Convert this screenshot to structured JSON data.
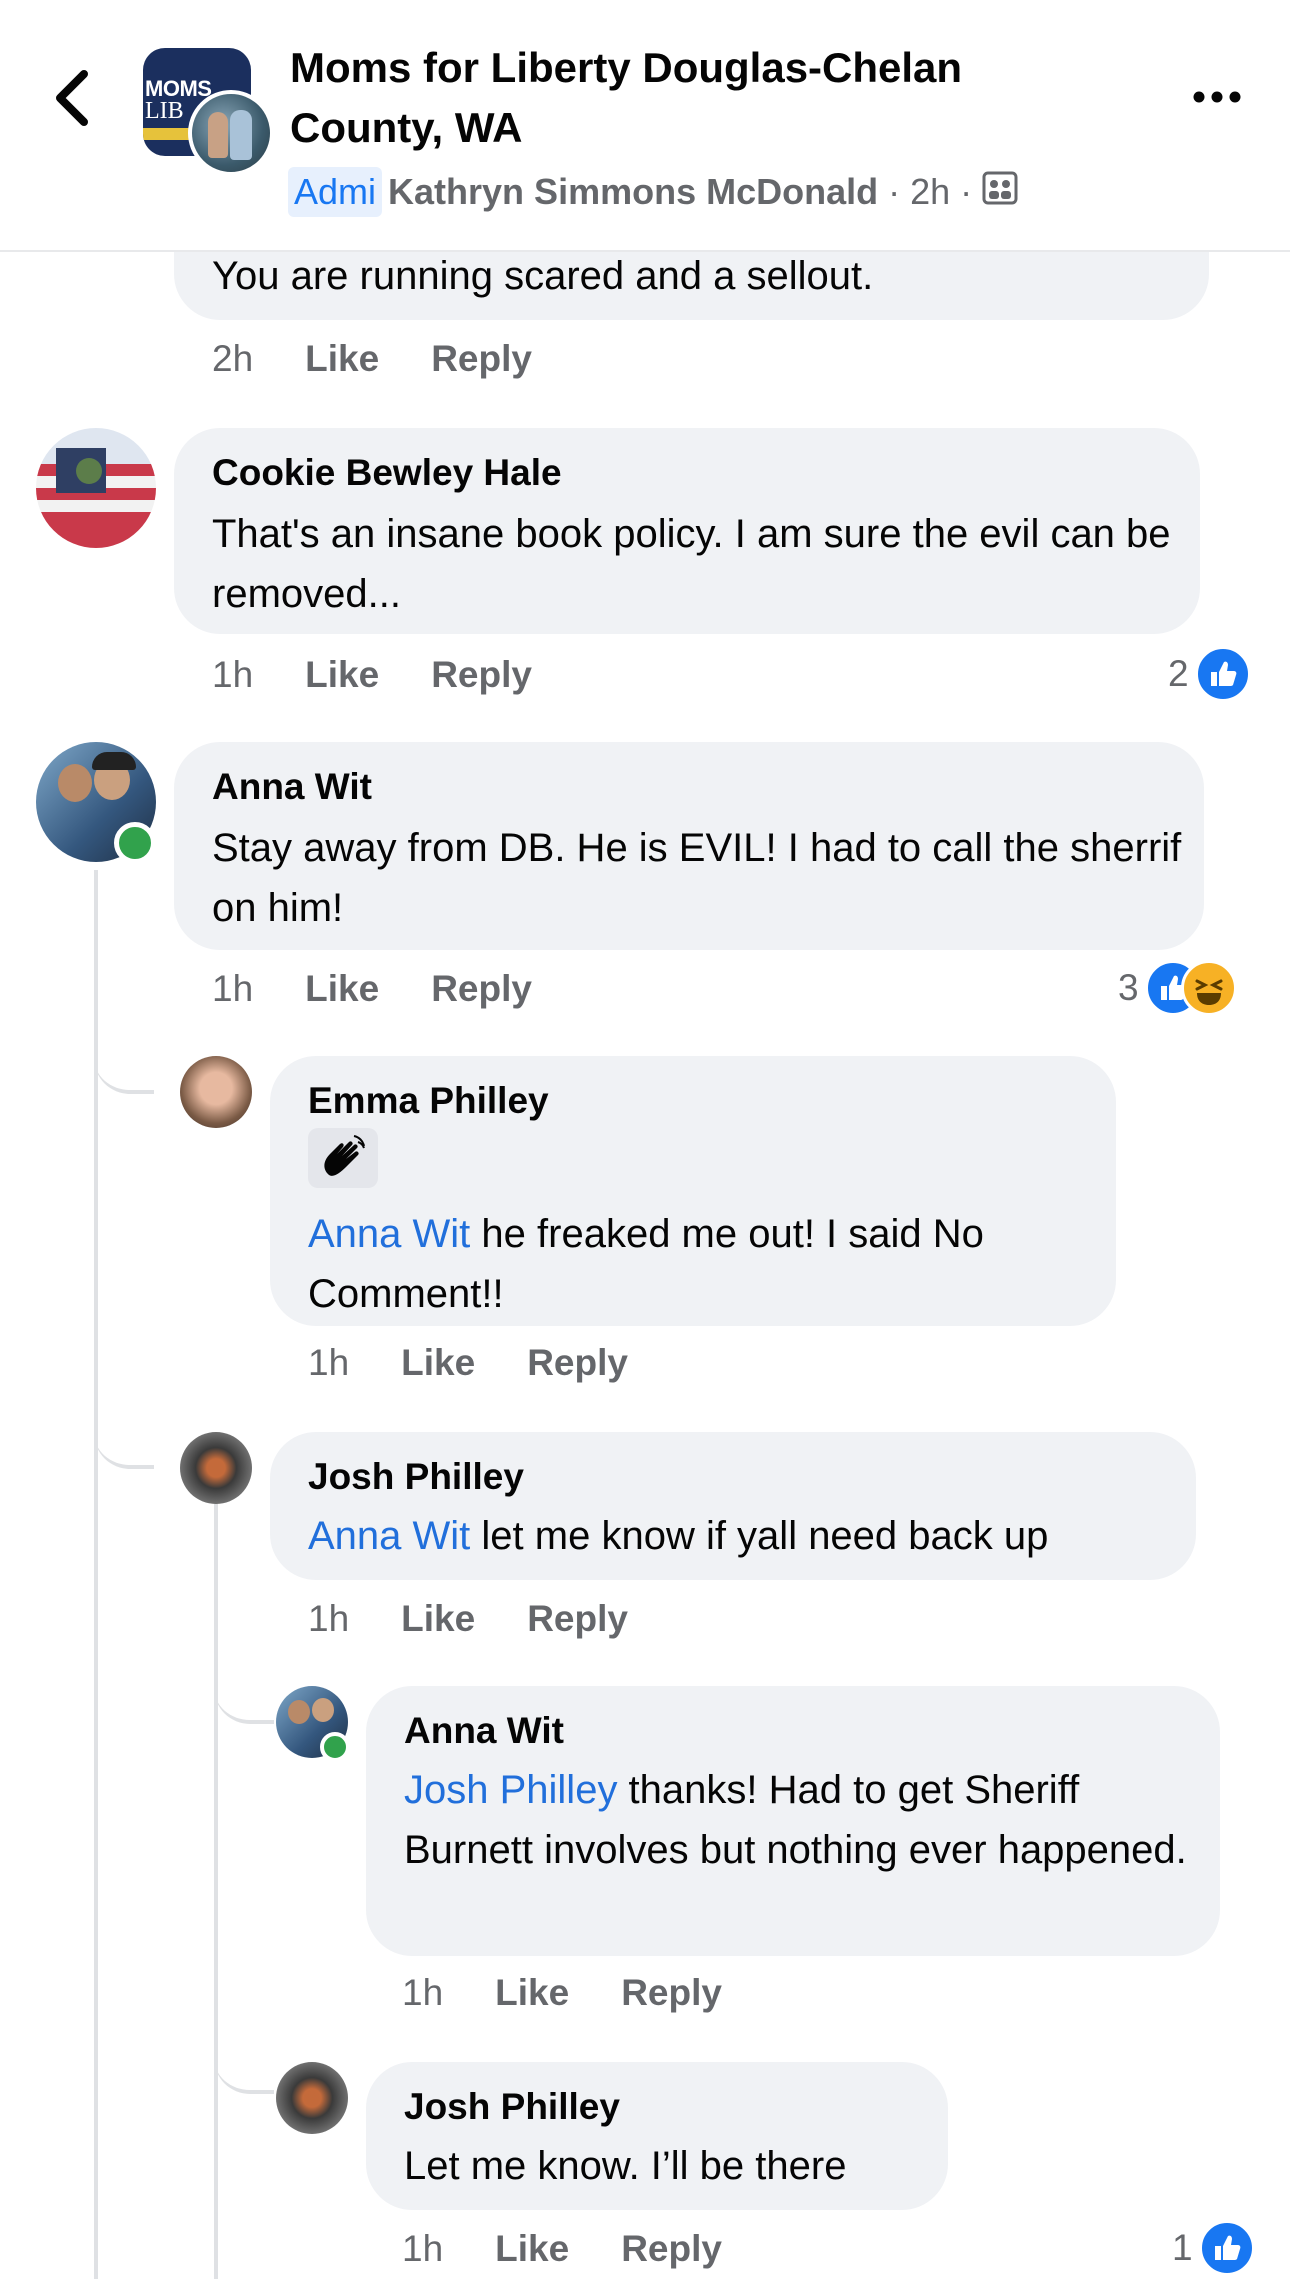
{
  "header": {
    "title": "Moms for Liberty Douglas-Chelan County, WA",
    "admin_badge": "Admi",
    "author": "Kathryn Simmons McDonald",
    "time": "· 2h ·",
    "page_logo_text_1": "MOMS",
    "page_logo_text_2": "LIB"
  },
  "comments": [
    {
      "text": "You are running scared and a sellout.",
      "time": "2h",
      "like": "Like",
      "reply": "Reply"
    },
    {
      "author": "Cookie Bewley Hale",
      "text": "That's an insane book policy. I am sure the evil can be removed...",
      "time": "1h",
      "like": "Like",
      "reply": "Reply",
      "reaction_count": "2"
    },
    {
      "author": "Anna Wit",
      "text": "Stay away from DB. He is EVIL! I had to call the sherrif on him!",
      "time": "1h",
      "like": "Like",
      "reply": "Reply",
      "reaction_count": "3"
    },
    {
      "author": "Emma Philley",
      "mention": "Anna Wit",
      "text": " he freaked me out! I said No Comment!!",
      "time": "1h",
      "like": "Like",
      "reply": "Reply"
    },
    {
      "author": "Josh Philley",
      "mention": "Anna Wit",
      "text": " let me know if yall need back up",
      "time": "1h",
      "like": "Like",
      "reply": "Reply"
    },
    {
      "author": "Anna Wit",
      "mention": "Josh Philley",
      "text": " thanks! Had to get Sheriff Burnett involves but nothing ever happened.",
      "time": "1h",
      "like": "Like",
      "reply": "Reply"
    },
    {
      "author": "Josh Philley",
      "text": "Let me know. I’ll be there",
      "time": "1h",
      "like": "Like",
      "reply": "Reply",
      "reaction_count": "1"
    }
  ],
  "colors": {
    "bubble": "#f0f2f5",
    "mention": "#216fdb",
    "meta": "#65676b",
    "like": "#1877f2",
    "online": "#31a24c"
  },
  "icons": [
    "back-arrow-icon",
    "more-icon",
    "group-icon",
    "like-icon",
    "haha-icon",
    "wave-icon"
  ]
}
